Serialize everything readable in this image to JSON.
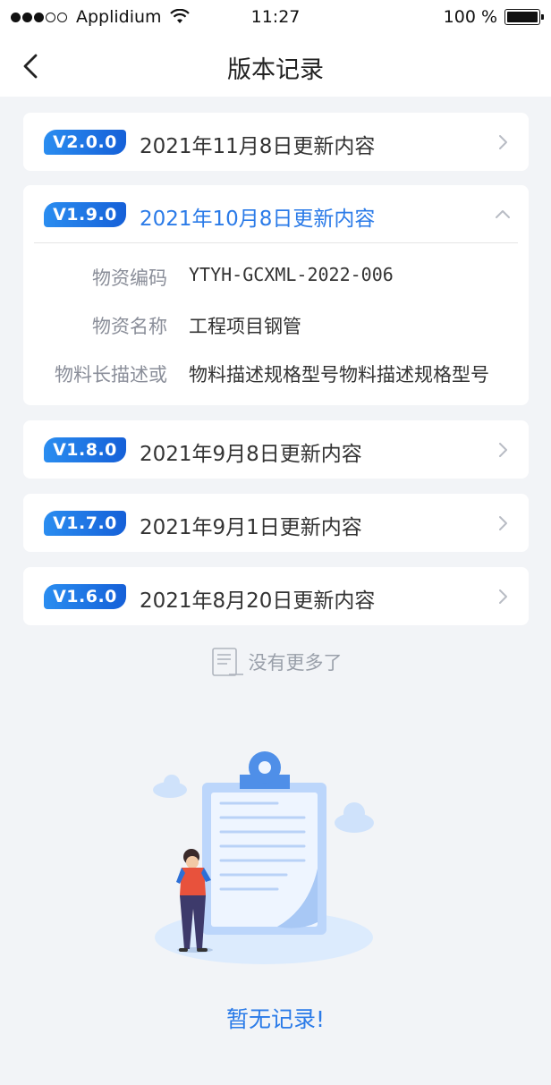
{
  "status": {
    "carrier": "Applidium",
    "time": "11:27",
    "battery": "100 %"
  },
  "nav": {
    "title": "版本记录"
  },
  "versions": [
    {
      "badge": "V2.0.0",
      "title": "2021年11月8日更新内容"
    },
    {
      "badge": "V1.9.0",
      "title": "2021年10月8日更新内容"
    },
    {
      "badge": "V1.8.0",
      "title": "2021年9月8日更新内容"
    },
    {
      "badge": "V1.7.0",
      "title": "2021年9月1日更新内容"
    },
    {
      "badge": "V1.6.0",
      "title": "2021年8月20日更新内容"
    }
  ],
  "details": [
    {
      "label": "物资编码",
      "value": "YTYH-GCXML-2022-006"
    },
    {
      "label": "物资名称",
      "value": "工程项目钢管"
    },
    {
      "label": "物料长描述或",
      "value": "物料描述规格型号物料描述规格型号"
    }
  ],
  "list_end": "没有更多了",
  "empty_state": "暂无记录!",
  "colors": {
    "accent": "#2b7be8",
    "badge_start": "#2a8df0",
    "badge_end": "#1560d8",
    "background": "#f2f4f7"
  },
  "icons": [
    "back-icon",
    "wifi-icon",
    "battery-icon",
    "collapse-icon",
    "expand-icon",
    "chevron-right-icon",
    "list-end-icon",
    "clipboard-illustration"
  ]
}
